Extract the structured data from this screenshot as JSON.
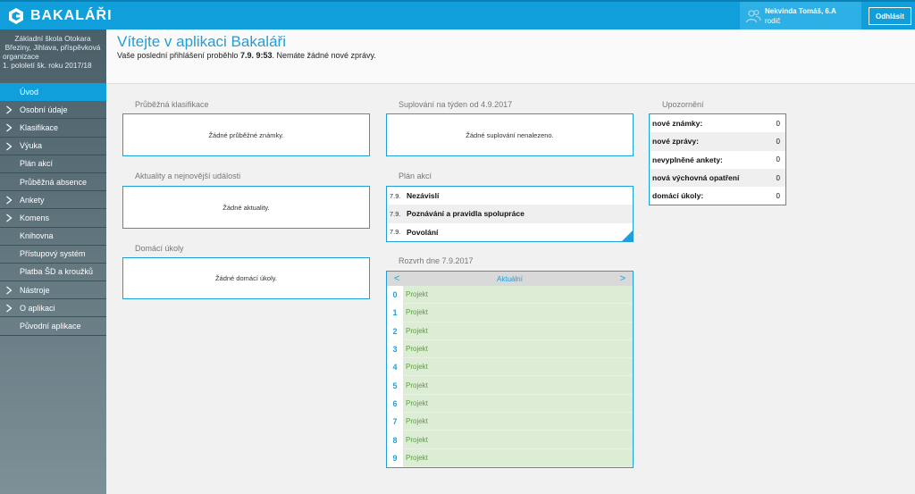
{
  "app": {
    "name": "BAKALÁŘI"
  },
  "user": {
    "name": "Nekvinda Tomáš, 6.A",
    "role": "rodič",
    "logout_label": "Odhlásit"
  },
  "school": {
    "line1": "Základní škola Otokara",
    "line2": "Březiny, Jihlava, příspěvková",
    "line3": "organizace",
    "line4": "1. pololetí šk. roku 2017/18"
  },
  "nav": [
    {
      "label": "Úvod",
      "active": true,
      "expandable": false
    },
    {
      "label": "Osobní údaje",
      "expandable": true
    },
    {
      "label": "Klasifikace",
      "expandable": true
    },
    {
      "label": "Výuka",
      "expandable": true
    },
    {
      "label": "Plán akcí",
      "expandable": false
    },
    {
      "label": "Průběžná absence",
      "expandable": false
    },
    {
      "label": "Ankety",
      "expandable": true
    },
    {
      "label": "Komens",
      "expandable": true
    },
    {
      "label": "Knihovna",
      "expandable": false
    },
    {
      "label": "Přístupový systém",
      "expandable": false
    },
    {
      "label": "Platba ŠD a kroužků",
      "expandable": false
    },
    {
      "label": "Nástroje",
      "expandable": true
    },
    {
      "label": "O aplikaci",
      "expandable": true
    },
    {
      "label": "Původní aplikace",
      "expandable": false
    }
  ],
  "header": {
    "title": "Vítejte v aplikaci Bakaláři",
    "sub_before": "Vaše poslední přihlášení proběhlo ",
    "sub_time": "7.9. 9:53",
    "sub_after": ". Nemáte žádné nové zprávy."
  },
  "sections": {
    "klasifikace": {
      "title": "Průběžná klasifikace",
      "empty": "Žádné průběžné známky."
    },
    "aktuality": {
      "title": "Aktuality a nejnovější události",
      "empty": "Žádné aktuality."
    },
    "ukoly": {
      "title": "Domácí úkoly",
      "empty": "Žádné domácí úkoly."
    },
    "suplovani": {
      "title": "Suplování na týden od 4.9.2017",
      "empty": "Žádné suplování nenalezeno."
    },
    "plan": {
      "title": "Plán akcí",
      "items": [
        {
          "date": "7.9.",
          "name": "Nezávislí"
        },
        {
          "date": "7.9.",
          "name": "Poznávání a pravidla spolupráce"
        },
        {
          "date": "7.9.",
          "name": "Povolání"
        }
      ],
      "plus": "+"
    },
    "rozvrh": {
      "title": "Rozvrh dne 7.9.2017",
      "current": "Aktuální",
      "prev": "<",
      "next": ">",
      "rows": [
        {
          "num": "0",
          "subject": "Projekt"
        },
        {
          "num": "1",
          "subject": "Projekt"
        },
        {
          "num": "2",
          "subject": "Projekt"
        },
        {
          "num": "3",
          "subject": "Projekt"
        },
        {
          "num": "4",
          "subject": "Projekt"
        },
        {
          "num": "5",
          "subject": "Projekt"
        },
        {
          "num": "6",
          "subject": "Projekt"
        },
        {
          "num": "7",
          "subject": "Projekt"
        },
        {
          "num": "8",
          "subject": "Projekt"
        },
        {
          "num": "9",
          "subject": "Projekt"
        }
      ]
    },
    "upozorneni": {
      "title": "Upozornění",
      "items": [
        {
          "label": "nové známky:",
          "value": "0"
        },
        {
          "label": "nové zprávy:",
          "value": "0"
        },
        {
          "label": "nevyplněné ankety:",
          "value": "0"
        },
        {
          "label": "nová výchovná opatření",
          "value": "0"
        },
        {
          "label": "domácí úkoly:",
          "value": "0"
        }
      ]
    }
  },
  "colors": {
    "brand": "#119fdc",
    "accent": "#1f9fd9",
    "lesson": "#dcecd5"
  }
}
